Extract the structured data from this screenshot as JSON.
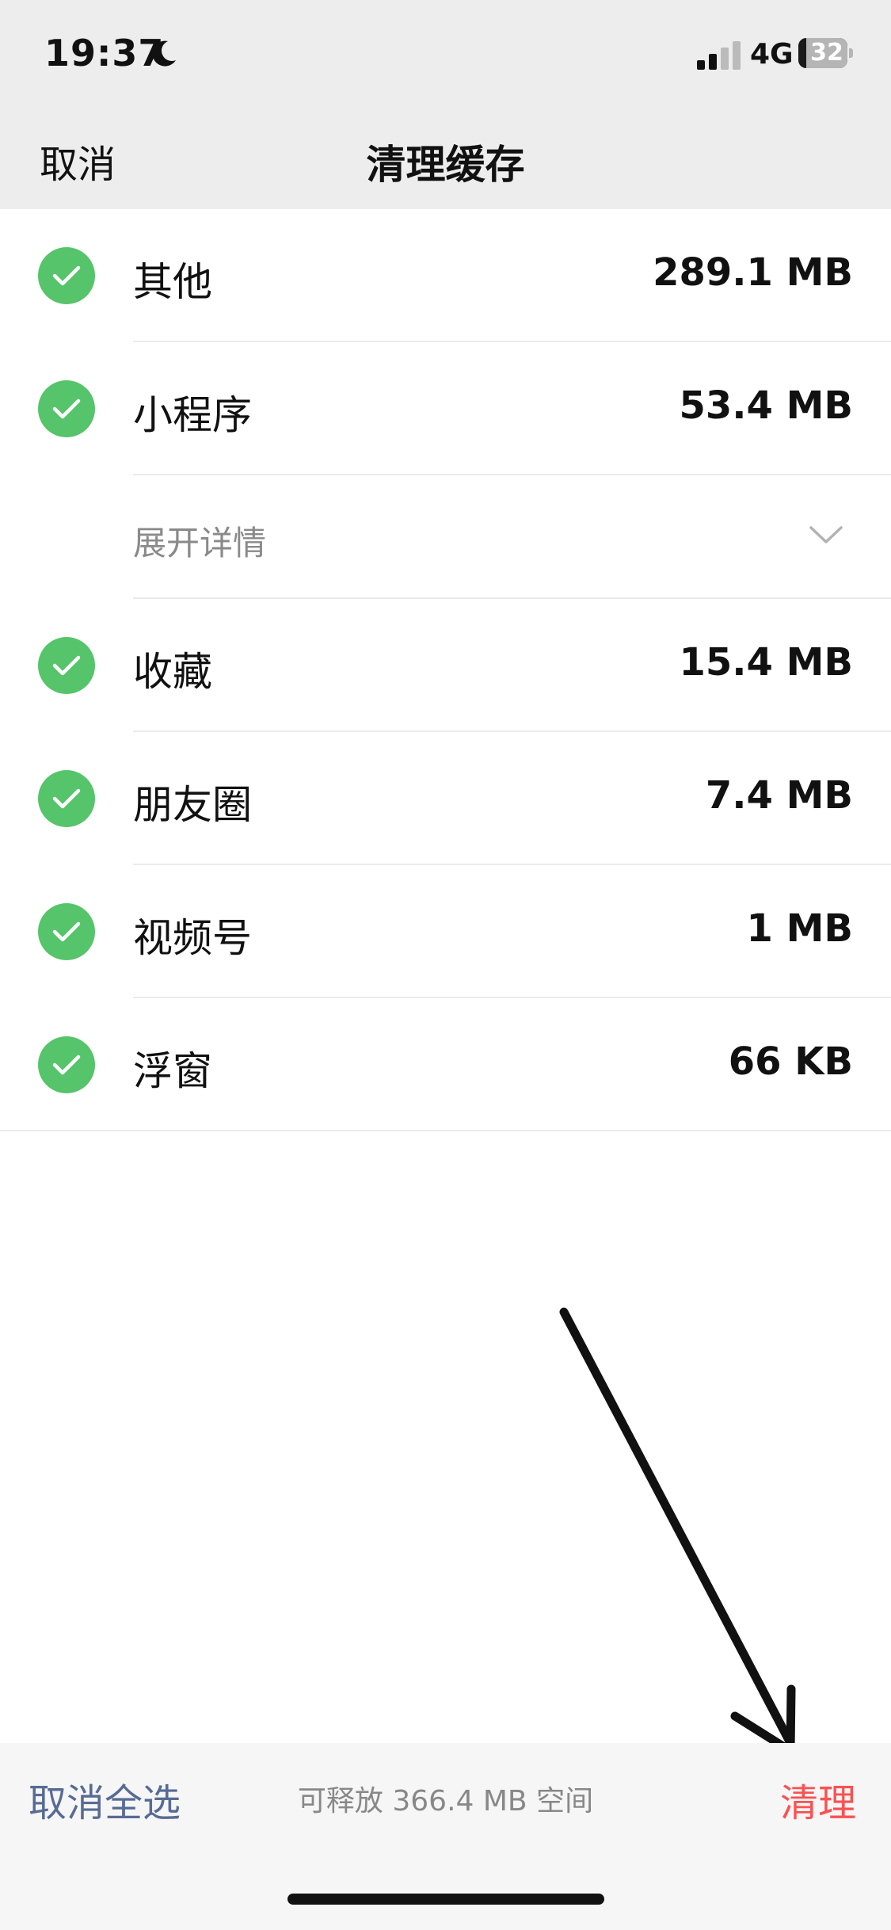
{
  "status": {
    "time": "19:37",
    "network": "4G",
    "battery": "32"
  },
  "nav": {
    "cancel": "取消",
    "title": "清理缓存"
  },
  "items": [
    {
      "label": "其他",
      "size": "289.1 MB",
      "checked": true
    },
    {
      "label": "小程序",
      "size": "53.4 MB",
      "checked": true
    },
    {
      "label": "收藏",
      "size": "15.4 MB",
      "checked": true
    },
    {
      "label": "朋友圈",
      "size": "7.4 MB",
      "checked": true
    },
    {
      "label": "视频号",
      "size": "1 MB",
      "checked": true
    },
    {
      "label": "浮窗",
      "size": "66 KB",
      "checked": true
    }
  ],
  "expand_details": "展开详情",
  "bottom": {
    "deselect_all": "取消全选",
    "free_space": "可释放 366.4 MB 空间",
    "clean": "清理"
  },
  "colors": {
    "check": "#56c46a",
    "link": "#576b95",
    "danger": "#fa5151"
  }
}
